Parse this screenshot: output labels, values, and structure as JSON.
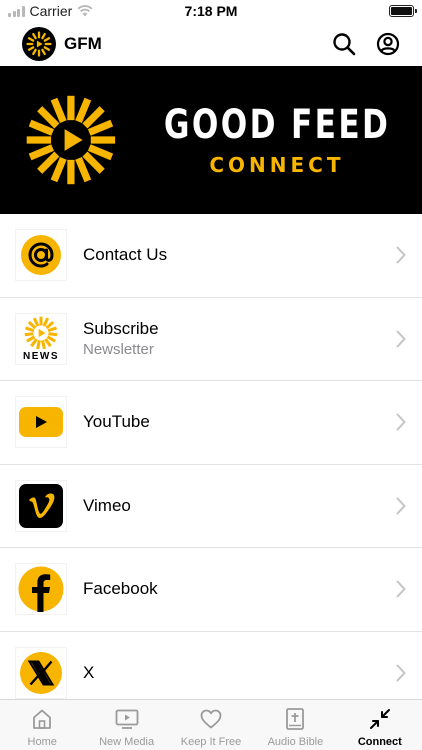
{
  "status_bar": {
    "carrier": "Carrier",
    "time": "7:18 PM"
  },
  "header": {
    "title": "GFM",
    "search_icon": "search-icon",
    "profile_icon": "profile-icon"
  },
  "banner": {
    "title": "GOOD FEED",
    "subtitle": "CONNECT"
  },
  "list": {
    "items": [
      {
        "title": "Contact Us",
        "icon": "at-sign-icon"
      },
      {
        "title": "Subscribe",
        "subtitle": "Newsletter",
        "icon": "news-icon",
        "icon_text": "NEWS"
      },
      {
        "title": "YouTube",
        "icon": "youtube-icon"
      },
      {
        "title": "Vimeo",
        "icon": "vimeo-icon"
      },
      {
        "title": "Facebook",
        "icon": "facebook-icon"
      },
      {
        "title": "X",
        "icon": "x-icon"
      }
    ]
  },
  "tab_bar": {
    "tabs": [
      {
        "label": "Home",
        "icon": "home-icon",
        "active": false
      },
      {
        "label": "New Media",
        "icon": "tv-icon",
        "active": false
      },
      {
        "label": "Keep It Free",
        "icon": "heart-icon",
        "active": false
      },
      {
        "label": "Audio Bible",
        "icon": "bible-icon",
        "active": false
      },
      {
        "label": "Connect",
        "icon": "connect-icon",
        "active": true
      }
    ]
  },
  "colors": {
    "accent": "#F7B500",
    "banner_bg": "#000000",
    "text": "#000000",
    "secondary_text": "#8A8A8E"
  }
}
